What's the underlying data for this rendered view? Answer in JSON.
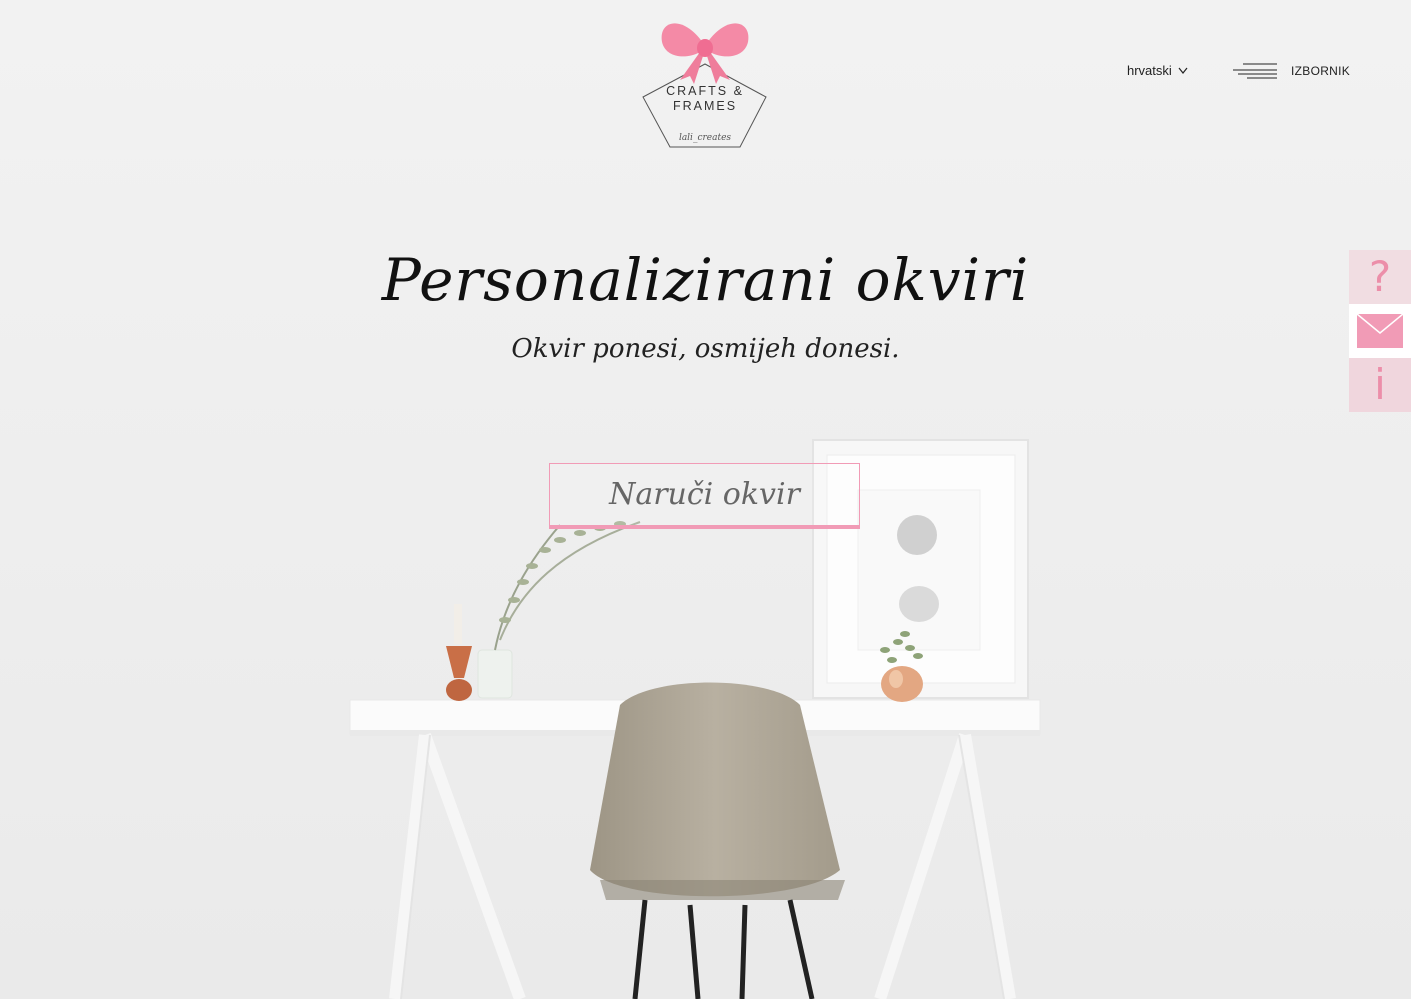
{
  "logo": {
    "line1": "CRAFTS &",
    "line2": "FRAMES",
    "signature": "lali_creates",
    "bow_color": "#f48aa6",
    "icon": "bow-icon"
  },
  "header": {
    "language": {
      "label": "hrvatski",
      "icon": "chevron-down-icon"
    },
    "menu": {
      "label": "IZBORNIK",
      "icon": "hamburger-icon"
    }
  },
  "hero": {
    "title": "Personalizirani okviri",
    "subtitle": "Okvir ponesi, osmijeh donesi.",
    "cta_label": "Naruči okvir"
  },
  "side_buttons": [
    {
      "glyph": "?",
      "icon": "question-icon"
    },
    {
      "glyph": "",
      "icon": "envelope-icon"
    },
    {
      "glyph": "i",
      "icon": "info-icon"
    }
  ],
  "colors": {
    "accent_pink": "#f19bb6",
    "side_pink": "#ec8ea9",
    "background": "#efefef"
  }
}
